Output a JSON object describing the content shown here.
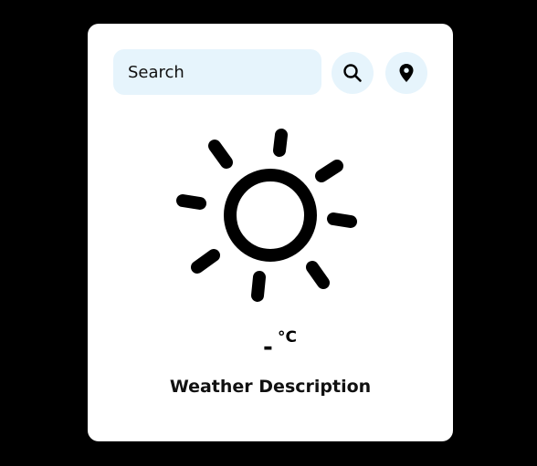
{
  "search": {
    "placeholder": "Search",
    "value": ""
  },
  "buttons": {
    "search_icon": "search-icon",
    "location_icon": "location-pin-icon"
  },
  "weather": {
    "icon": "sun-icon",
    "temperature": "-",
    "unit": "°C",
    "description": "Weather Description"
  },
  "colors": {
    "background": "#000000",
    "card": "#ffffff",
    "input_bg": "#e6f4fc",
    "text": "#111111"
  }
}
